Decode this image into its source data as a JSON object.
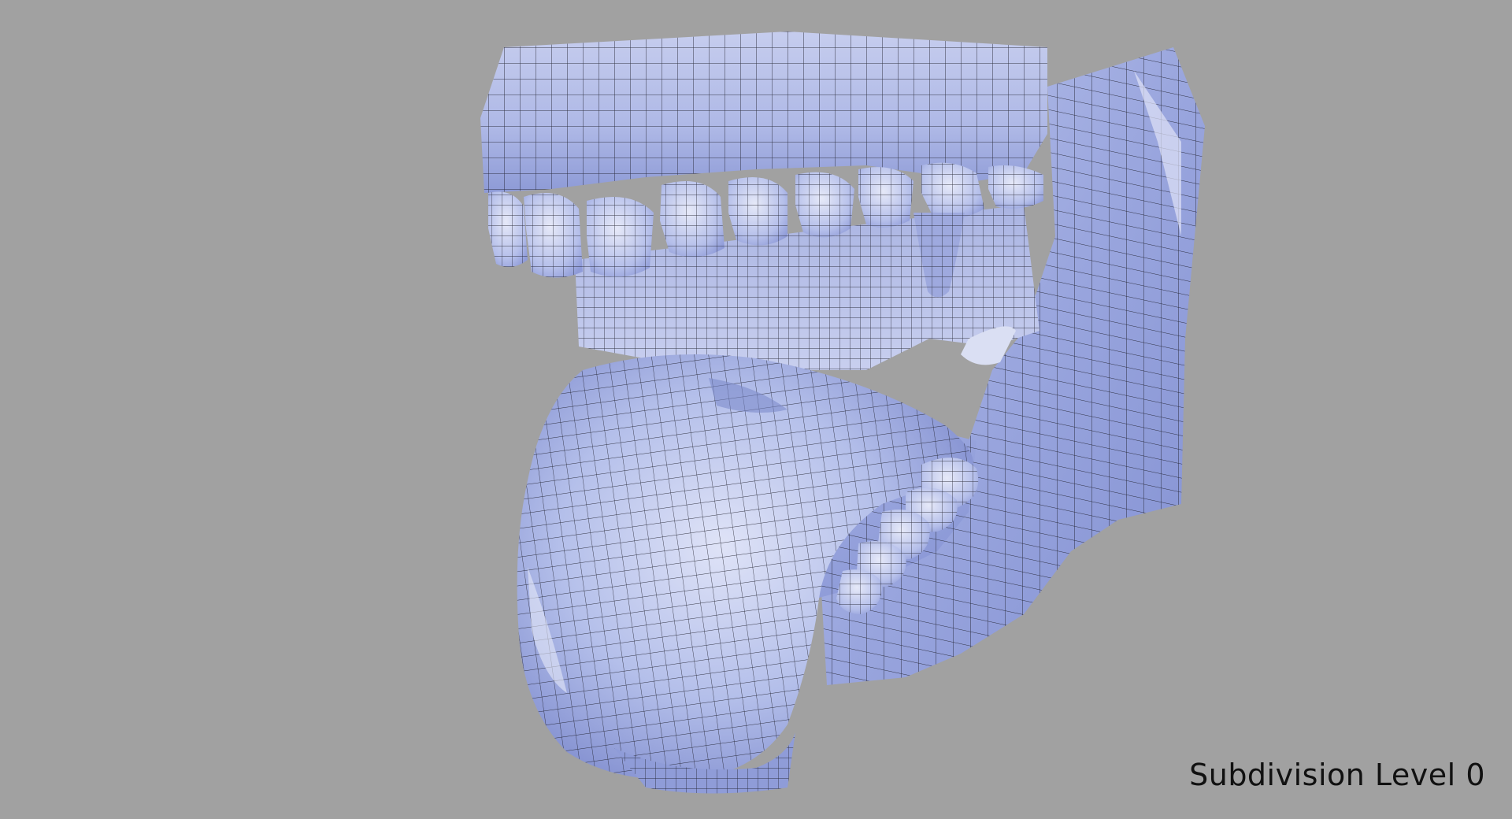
{
  "caption": "Subdivision Level 0",
  "colors": {
    "background": "#a1a1a1",
    "mesh_base": "#b8c2ea",
    "mesh_shadow": "#7f8ccc",
    "mesh_highlight": "#e4e8f8",
    "wire": "#1c1c28",
    "caption_text": "#111111"
  }
}
